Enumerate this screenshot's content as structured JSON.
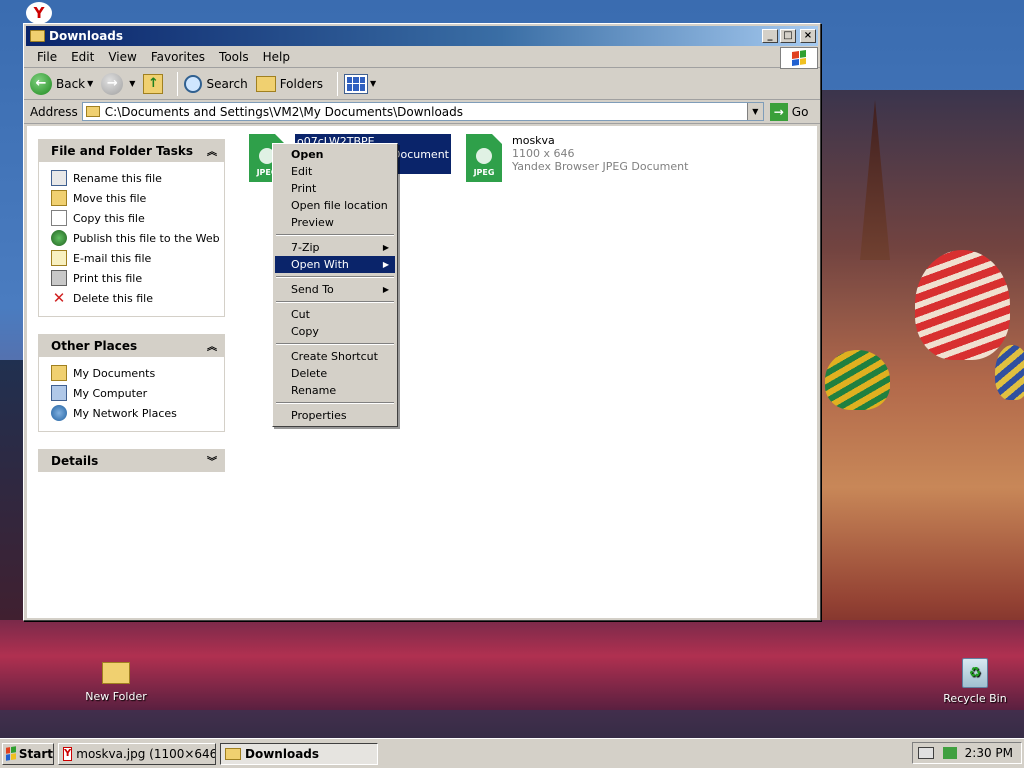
{
  "window": {
    "title": "Downloads",
    "controls": {
      "minimize": "_",
      "maximize": "□",
      "close": "×"
    }
  },
  "menubar": [
    "File",
    "Edit",
    "View",
    "Favorites",
    "Tools",
    "Help"
  ],
  "toolbar": {
    "back": "Back",
    "search": "Search",
    "folders": "Folders"
  },
  "address": {
    "label": "Address",
    "value": "C:\\Documents and Settings\\VM2\\My Documents\\Downloads",
    "go": "Go"
  },
  "sidebar": {
    "file_tasks": {
      "title": "File and Folder Tasks",
      "items": [
        {
          "label": "Rename this file",
          "icon": "rename-icon"
        },
        {
          "label": "Move this file",
          "icon": "move-icon"
        },
        {
          "label": "Copy this file",
          "icon": "copy-icon"
        },
        {
          "label": "Publish this file to the Web",
          "icon": "globe-icon"
        },
        {
          "label": "E-mail this file",
          "icon": "email-icon"
        },
        {
          "label": "Print this file",
          "icon": "printer-icon"
        },
        {
          "label": "Delete this file",
          "icon": "delete-icon"
        }
      ]
    },
    "other_places": {
      "title": "Other Places",
      "items": [
        {
          "label": "My Documents",
          "icon": "my-documents-icon"
        },
        {
          "label": "My Computer",
          "icon": "my-computer-icon"
        },
        {
          "label": "My Network Places",
          "icon": "network-icon"
        }
      ]
    },
    "details": {
      "title": "Details"
    }
  },
  "files": [
    {
      "name": "o07cLW2TBPE",
      "sub1": "",
      "sub2": "Document",
      "icon_label": "JPEG",
      "selected": true
    },
    {
      "name": "moskva",
      "sub1": "1100 x 646",
      "sub2": "Yandex Browser JPEG Document",
      "icon_label": "JPEG",
      "selected": false
    }
  ],
  "context_menu": {
    "items": [
      {
        "label": "Open",
        "bold": true
      },
      {
        "label": "Edit"
      },
      {
        "label": "Print"
      },
      {
        "label": "Open file location"
      },
      {
        "label": "Preview"
      },
      {
        "sep": true
      },
      {
        "label": "7-Zip",
        "submenu": true
      },
      {
        "label": "Open With",
        "submenu": true,
        "active": true
      },
      {
        "sep": true
      },
      {
        "label": "Send To",
        "submenu": true
      },
      {
        "sep": true
      },
      {
        "label": "Cut"
      },
      {
        "label": "Copy"
      },
      {
        "sep": true
      },
      {
        "label": "Create Shortcut"
      },
      {
        "label": "Delete"
      },
      {
        "label": "Rename"
      },
      {
        "sep": true
      },
      {
        "label": "Properties"
      }
    ]
  },
  "desktop": {
    "new_folder": "New Folder",
    "recycle_bin": "Recycle Bin"
  },
  "taskbar": {
    "start": "Start",
    "tasks": [
      {
        "label": "moskva.jpg (1100×646) ...",
        "icon": "yandex-icon",
        "active": false
      },
      {
        "label": "Downloads",
        "icon": "folder-icon",
        "active": true
      }
    ],
    "clock": "2:30 PM"
  }
}
